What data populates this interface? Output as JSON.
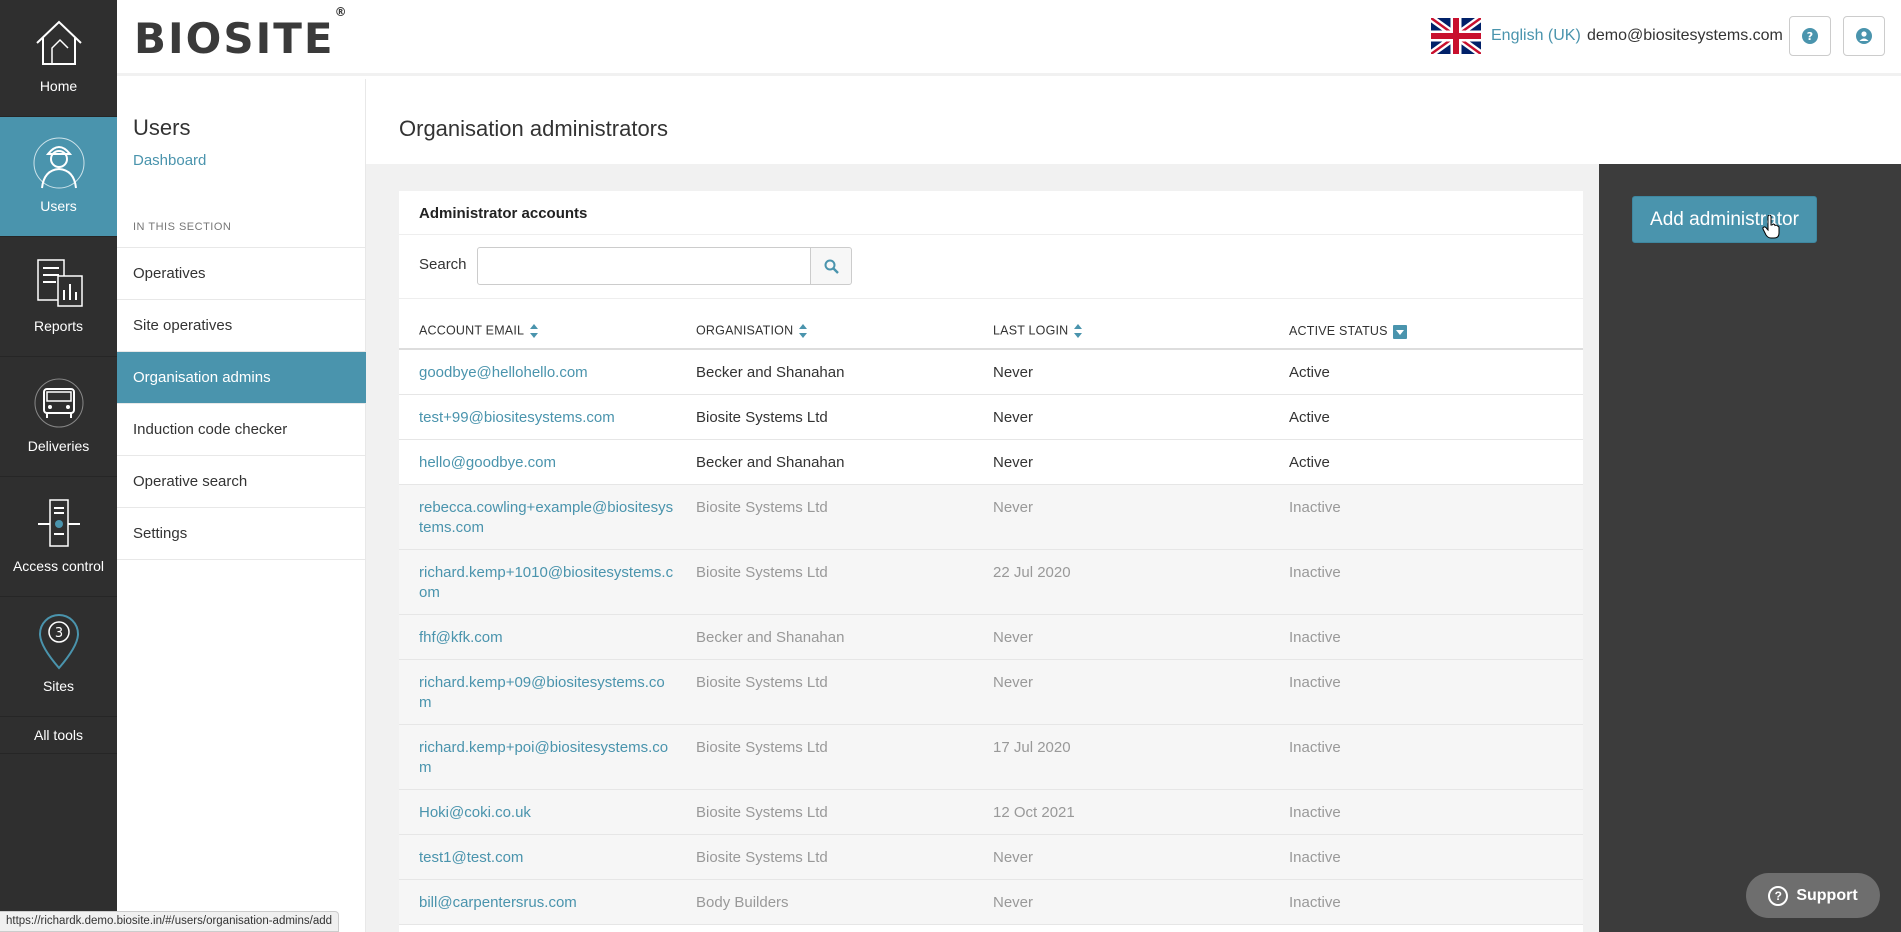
{
  "rail": {
    "home": "Home",
    "users": "Users",
    "reports": "Reports",
    "deliveries": "Deliveries",
    "access_control": "Access control",
    "sites": "Sites",
    "all_tools": "All tools"
  },
  "header": {
    "logo": "BIOSITE",
    "logo_mark": "®",
    "language": "English (UK)",
    "user_email": "demo@biositesystems.com",
    "help_icon": "question-circle-icon",
    "account_icon": "user-circle-icon"
  },
  "subnav": {
    "title": "Users",
    "dashboard": "Dashboard",
    "section_label": "IN THIS SECTION",
    "items": [
      {
        "label": "Operatives"
      },
      {
        "label": "Site operatives"
      },
      {
        "label": "Organisation admins"
      },
      {
        "label": "Induction code checker"
      },
      {
        "label": "Operative search"
      },
      {
        "label": "Settings"
      }
    ]
  },
  "main": {
    "page_title": "Organisation administrators",
    "card_title": "Administrator accounts",
    "search_label": "Search",
    "search_value": "",
    "columns": {
      "email": "ACCOUNT EMAIL",
      "organisation": "ORGANISATION",
      "last_login": "LAST LOGIN",
      "active_status": "ACTIVE STATUS"
    },
    "rows": [
      {
        "email": "goodbye@hellohello.com",
        "organisation": "Becker and Shanahan",
        "last_login": "Never",
        "status": "Active"
      },
      {
        "email": "test+99@biositesystems.com",
        "organisation": "Biosite Systems Ltd",
        "last_login": "Never",
        "status": "Active"
      },
      {
        "email": "hello@goodbye.com",
        "organisation": "Becker and Shanahan",
        "last_login": "Never",
        "status": "Active"
      },
      {
        "email": "rebecca.cowling+example@biositesystems.com",
        "organisation": "Biosite Systems Ltd",
        "last_login": "Never",
        "status": "Inactive"
      },
      {
        "email": "richard.kemp+1010@biositesystems.com",
        "organisation": "Biosite Systems Ltd",
        "last_login": "22 Jul 2020",
        "status": "Inactive"
      },
      {
        "email": "fhf@kfk.com",
        "organisation": "Becker and Shanahan",
        "last_login": "Never",
        "status": "Inactive"
      },
      {
        "email": "richard.kemp+09@biositesystems.com",
        "organisation": "Biosite Systems Ltd",
        "last_login": "Never",
        "status": "Inactive"
      },
      {
        "email": "richard.kemp+poi@biositesystems.com",
        "organisation": "Biosite Systems Ltd",
        "last_login": "17 Jul 2020",
        "status": "Inactive"
      },
      {
        "email": "Hoki@coki.co.uk",
        "organisation": "Biosite Systems Ltd",
        "last_login": "12 Oct 2021",
        "status": "Inactive"
      },
      {
        "email": "test1@test.com",
        "organisation": "Biosite Systems Ltd",
        "last_login": "Never",
        "status": "Inactive"
      },
      {
        "email": "bill@carpentersrus.com",
        "organisation": "Body Builders",
        "last_login": "Never",
        "status": "Inactive"
      }
    ]
  },
  "right": {
    "add_button": "Add administrator"
  },
  "support": {
    "label": "Support"
  },
  "statusbar": {
    "url": "https://richardk.demo.biosite.in/#/users/organisation-admins/add"
  },
  "colors": {
    "accent": "#4a94ad",
    "rail_bg": "#2f2f2f",
    "right_panel_bg": "#3c3c3c"
  }
}
